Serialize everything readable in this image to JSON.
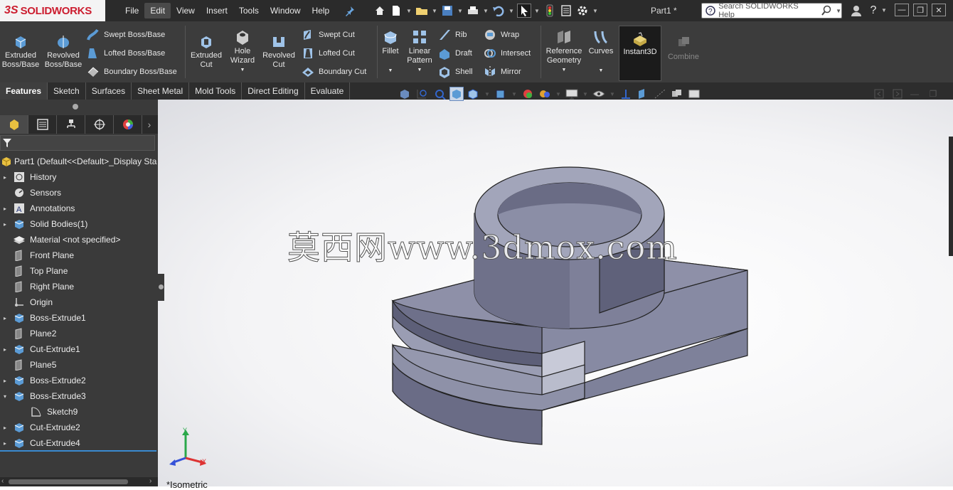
{
  "app": {
    "brand_ds": "3S",
    "brand_name": "SOLIDWORKS",
    "document_title": "Part1 *"
  },
  "menu": [
    "File",
    "Edit",
    "View",
    "Insert",
    "Tools",
    "Window",
    "Help"
  ],
  "search": {
    "placeholder": "Search SOLIDWORKS Help"
  },
  "ribbon": {
    "extruded_boss": "Extruded\nBoss/Base",
    "revolved_boss": "Revolved\nBoss/Base",
    "swept_boss": "Swept Boss/Base",
    "lofted_boss": "Lofted Boss/Base",
    "boundary_boss": "Boundary Boss/Base",
    "extruded_cut": "Extruded\nCut",
    "hole_wizard": "Hole\nWizard",
    "revolved_cut": "Revolved\nCut",
    "swept_cut": "Swept Cut",
    "lofted_cut": "Lofted Cut",
    "boundary_cut": "Boundary Cut",
    "fillet": "Fillet",
    "linear_pattern": "Linear\nPattern",
    "rib": "Rib",
    "draft": "Draft",
    "shell": "Shell",
    "wrap": "Wrap",
    "intersect": "Intersect",
    "mirror": "Mirror",
    "reference_geometry": "Reference\nGeometry",
    "curves": "Curves",
    "instant3d": "Instant3D",
    "combine": "Combine"
  },
  "tabs": [
    "Features",
    "Sketch",
    "Surfaces",
    "Sheet Metal",
    "Mold Tools",
    "Direct Editing",
    "Evaluate"
  ],
  "tree": {
    "root": "Part1  (Default<<Default>_Display Sta",
    "items": [
      {
        "label": "History",
        "arrow": "▸"
      },
      {
        "label": "Sensors",
        "arrow": ""
      },
      {
        "label": "Annotations",
        "arrow": "▸"
      },
      {
        "label": "Solid Bodies(1)",
        "arrow": "▸"
      },
      {
        "label": "Material <not specified>",
        "arrow": ""
      },
      {
        "label": "Front Plane",
        "arrow": ""
      },
      {
        "label": "Top Plane",
        "arrow": ""
      },
      {
        "label": "Right Plane",
        "arrow": ""
      },
      {
        "label": "Origin",
        "arrow": ""
      },
      {
        "label": "Boss-Extrude1",
        "arrow": "▸"
      },
      {
        "label": "Plane2",
        "arrow": ""
      },
      {
        "label": "Cut-Extrude1",
        "arrow": "▸"
      },
      {
        "label": "Plane5",
        "arrow": ""
      },
      {
        "label": "Boss-Extrude2",
        "arrow": "▸"
      },
      {
        "label": "Boss-Extrude3",
        "arrow": "▾"
      },
      {
        "label": "Sketch9",
        "arrow": ""
      },
      {
        "label": "Cut-Extrude2",
        "arrow": "▸"
      },
      {
        "label": "Cut-Extrude4",
        "arrow": "▸"
      }
    ]
  },
  "viewport": {
    "view_name": "*Isometric",
    "watermark": "莫西网www.3dmox.com",
    "triad_x": "X",
    "triad_y": "Y"
  }
}
